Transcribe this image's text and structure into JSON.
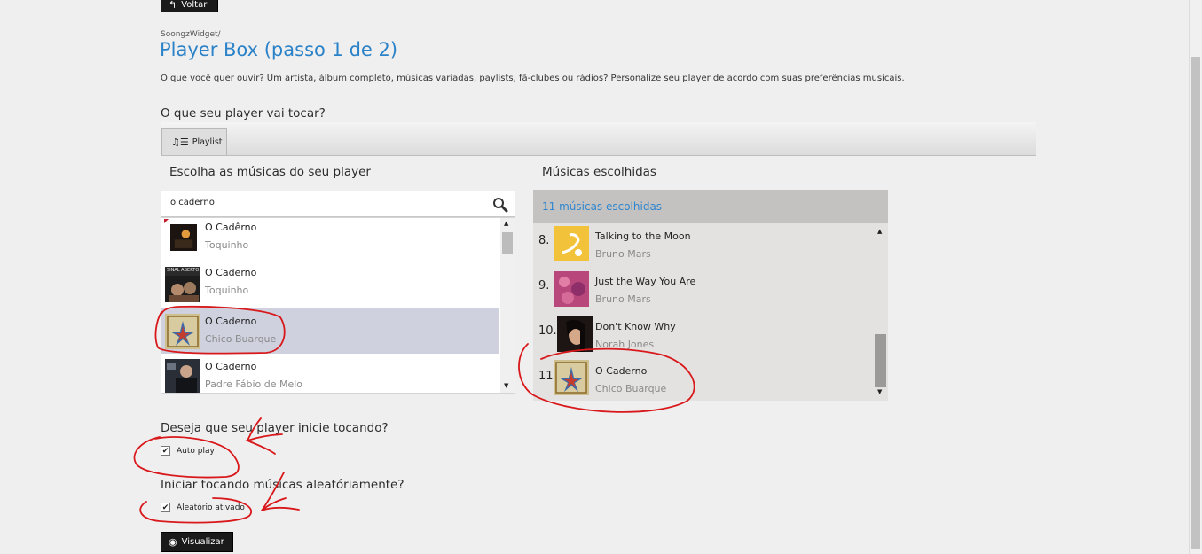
{
  "header": {
    "back_label": "Voltar",
    "breadcrumb": "SoongzWidget/",
    "title": "Player Box (passo 1 de 2)",
    "description": "O que você quer ouvir? Um artista, álbum completo, músicas variadas, paylists, fã-clubes ou rádios? Personalize seu player de acordo com suas preferências musicais."
  },
  "section_player": {
    "heading": "O que seu player vai tocar?",
    "tab_label": "Playlist"
  },
  "left": {
    "heading": "Escolha as músicas do seu player",
    "search_value": "o caderno",
    "results": [
      {
        "title": "O Cadêrno",
        "artist": "Toquinho"
      },
      {
        "title": "O Caderno",
        "artist": "Toquinho"
      },
      {
        "title": "O Caderno",
        "artist": "Chico Buarque"
      },
      {
        "title": "O Caderno",
        "artist": "Padre Fábio de Melo"
      }
    ],
    "album_art_text": "SINAL ABERTO"
  },
  "right": {
    "heading": "Músicas escolhidas",
    "count_label": "11 músicas escolhidas",
    "items": [
      {
        "num": "8.",
        "title": "Talking to the Moon",
        "artist": "Bruno Mars"
      },
      {
        "num": "9.",
        "title": "Just the Way You Are",
        "artist": "Bruno Mars"
      },
      {
        "num": "10.",
        "title": "Don't Know Why",
        "artist": "Norah Jones"
      },
      {
        "num": "11.",
        "title": "O Caderno",
        "artist": "Chico Buarque"
      }
    ]
  },
  "autoplay": {
    "heading": "Deseja que seu player inicie tocando?",
    "checkbox_label": "Auto play",
    "checked": true
  },
  "shuffle": {
    "heading": "Iniciar tocando músicas aleatóriamente?",
    "checkbox_label": "Aleatório ativado",
    "checked": true
  },
  "footer": {
    "preview_label": "Visualizar"
  },
  "colors": {
    "title_blue": "#2a82c8",
    "selection": "#cfd1de",
    "annotation_red": "#d8181b"
  }
}
